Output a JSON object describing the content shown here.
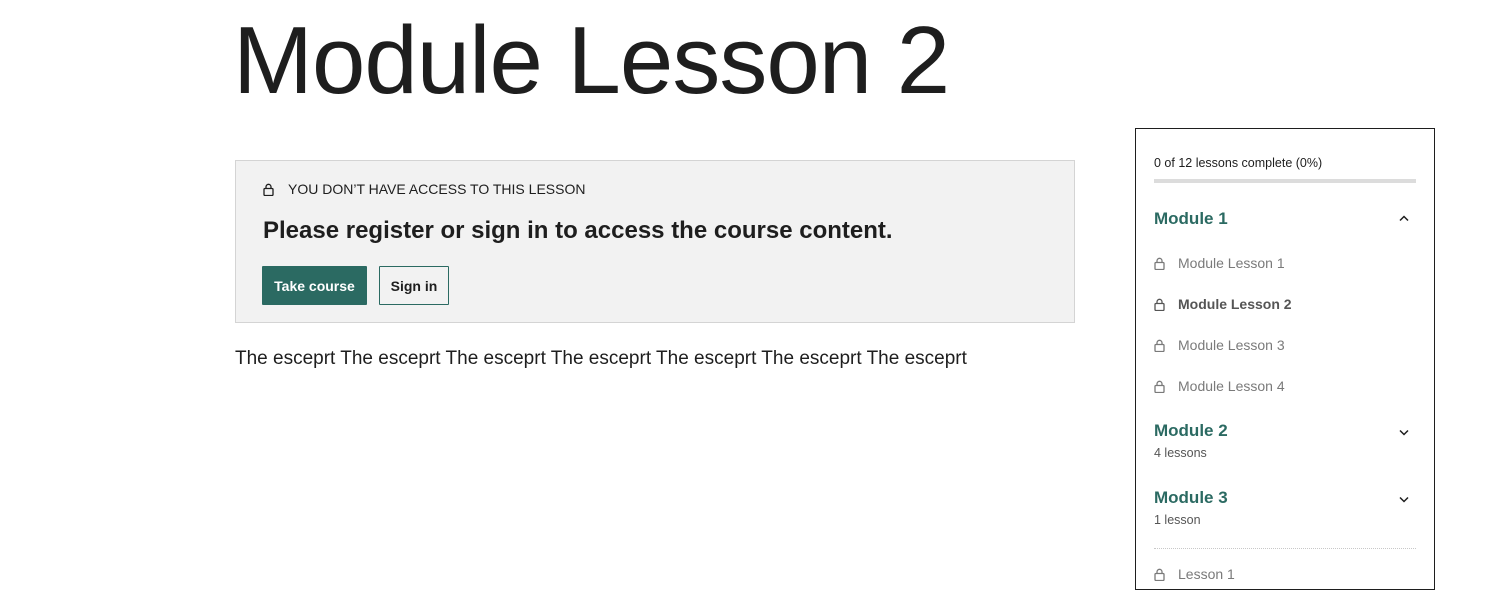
{
  "page": {
    "title": "Module Lesson 2",
    "excerpt": "The esceprt The esceprt The esceprt The esceprt The esceprt The esceprt The esceprt"
  },
  "notice": {
    "heading": "YOU DON’T HAVE ACCESS TO THIS LESSON",
    "message": "Please register or sign in to access the course content.",
    "take_course_label": "Take course",
    "sign_in_label": "Sign in",
    "icon": "lock-icon"
  },
  "sidebar": {
    "progress_text": "0 of 12 lessons complete (0%)",
    "progress_value": 0,
    "modules": [
      {
        "title": "Module 1",
        "expanded": true,
        "lessons": [
          {
            "label": "Module Lesson 1",
            "current": false
          },
          {
            "label": "Module Lesson 2",
            "current": true
          },
          {
            "label": "Module Lesson 3",
            "current": false
          },
          {
            "label": "Module Lesson 4",
            "current": false
          }
        ]
      },
      {
        "title": "Module 2",
        "subtitle": "4 lessons",
        "expanded": false
      },
      {
        "title": "Module 3",
        "subtitle": "1 lesson",
        "expanded": false
      }
    ],
    "extra_lessons": [
      {
        "label": "Lesson 1"
      }
    ]
  },
  "colors": {
    "accent": "#2b6a62",
    "text": "#1e1e1e",
    "muted": "#7a7a7a",
    "notice_bg": "#f2f2f2"
  }
}
